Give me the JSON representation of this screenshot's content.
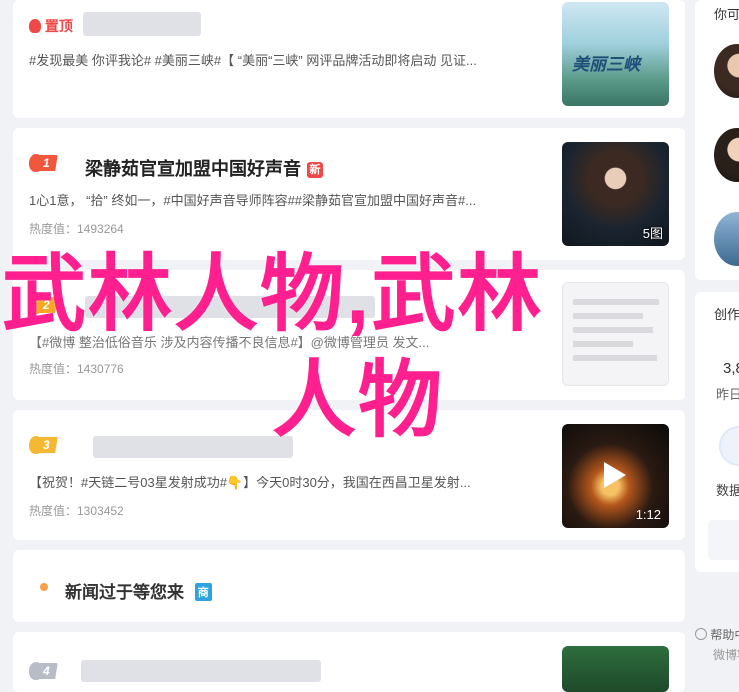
{
  "feed": [
    {
      "rank": "",
      "title": "",
      "tag": "置顶",
      "excerpt": "#发现最美 你评我论# #美丽三峡#【 “美丽“三峡” 网评品牌活动即将启动 见证...",
      "heat": "",
      "thumb_text": "美丽三峡",
      "thumb_sub": "",
      "thumb_badge": ""
    },
    {
      "rank": "1",
      "title": "梁静茹官宣加盟中国好声音",
      "tag": "新",
      "excerpt": "1心1意， “拾” 终如一，#中国好声音导师阵容##梁静茹官宣加盟中国好声音#...",
      "heat": "热度值：1493264",
      "thumb_text": "",
      "thumb_sub": "",
      "thumb_badge": "5图"
    },
    {
      "rank": "2",
      "title": "",
      "tag": "",
      "excerpt": "【#微博 整治低俗音乐 涉及内容传播不良信息#】@微博管理员 发文...",
      "heat": "热度值：1430776",
      "thumb_text": "",
      "thumb_sub": "",
      "thumb_badge": ""
    },
    {
      "rank": "3",
      "title": "",
      "tag": "",
      "excerpt": "【祝贺！#天链二号03星发射成功#👇】今天0时30分，我国在西昌卫星发射...",
      "heat": "热度值：1303452",
      "thumb_text": "",
      "thumb_sub": "",
      "thumb_badge": "1:12"
    }
  ],
  "promo": {
    "title": "新闻过于等您来",
    "tag": "商"
  },
  "last_rank": "4",
  "overlay": {
    "line1": "武林人物,武林",
    "line2": "人物"
  },
  "sidebar": {
    "header": "你可",
    "section2": "创作",
    "stat_value": "3,8",
    "stat_label": "昨日",
    "data_label": "数据",
    "help_text": "帮助中",
    "footer_text": "微博客"
  },
  "colors": {
    "accent_pink": "#ff1f8e",
    "flame_red": "#f0573c",
    "flame_orange": "#f5a623",
    "badge_red": "#f04848"
  }
}
